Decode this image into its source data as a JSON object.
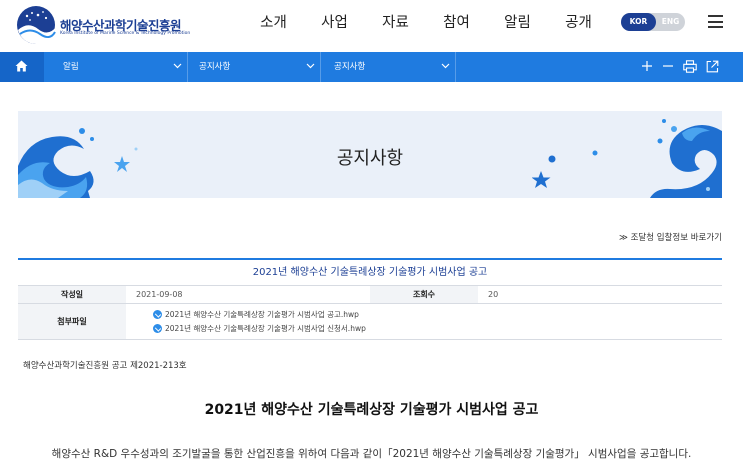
{
  "header": {
    "logo_title": "해양수산과학기술진흥원",
    "logo_subtitle": "Korea Institute of Marine Science & Technology Promotion",
    "nav": [
      "소개",
      "사업",
      "자료",
      "참여",
      "알림",
      "공개"
    ],
    "lang": {
      "active": "KOR",
      "inactive": "ENG"
    },
    "menu_icon": "hamburger-icon",
    "brand_color": "#1c3f94"
  },
  "location": {
    "home_icon": "home-icon",
    "items": [
      "알림",
      "공지사항",
      "공지사항"
    ],
    "tools": [
      "plus-icon",
      "minus-icon",
      "print-icon",
      "share-icon"
    ],
    "bar_color": "#1f7be0"
  },
  "banner": {
    "title": "공지사항"
  },
  "shortcut": {
    "label": "≫ 조달청 입찰정보 바로가기"
  },
  "board": {
    "title": "2021년 해양수산 기술특례상장 기술평가 시범사업 공고",
    "date_label": "작성일",
    "date_value": "2021-09-08",
    "views_label": "조회수",
    "views_value": "20",
    "files_label": "첨부파일",
    "files": [
      "2021년 해양수산 기술특례상장 기술평가 시범사업 공고.hwp",
      "2021년 해양수산 기술특례상장 기술평가 시범사업 신청서.hwp"
    ]
  },
  "content": {
    "notice_no": "해양수산과학기술진흥원 공고 제2021-213호",
    "title": "2021년 해양수산 기술특례상장 기술평가 시범사업 공고",
    "body": "해양수산 R&D 우수성과의 조기발굴을 통한 산업진흥을 위하여 다음과 같이「2021년 해양수산 기술특례상장 기술평가」 시범사업을 공고합니다."
  }
}
